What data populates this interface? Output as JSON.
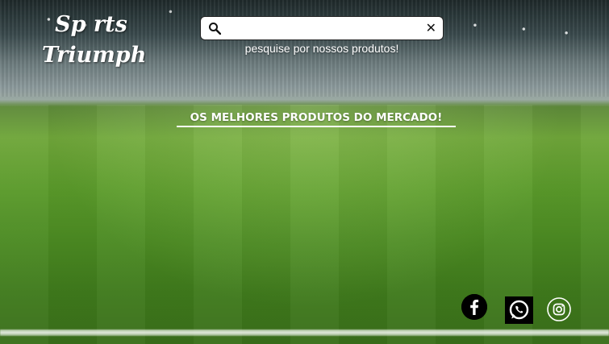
{
  "brand": {
    "line1": "Sp rts",
    "line2": "Triumph"
  },
  "search": {
    "value": "",
    "placeholder": "",
    "caption": "pesquise por nossos produtos!",
    "clear_label": "✕",
    "icons": {
      "search": "search-icon",
      "clear": "close-icon"
    }
  },
  "hero": {
    "tagline": "OS MELHORES PRODUTOS DO MERCADO!"
  },
  "social": [
    {
      "name": "facebook",
      "icon": "facebook-icon"
    },
    {
      "name": "whatsapp",
      "icon": "whatsapp-icon"
    },
    {
      "name": "instagram",
      "icon": "instagram-icon"
    }
  ],
  "colors": {
    "text": "#ffffff",
    "grass": "#5a9a2a",
    "sky": "#8f9c9e",
    "icon_bg": "#000000"
  }
}
